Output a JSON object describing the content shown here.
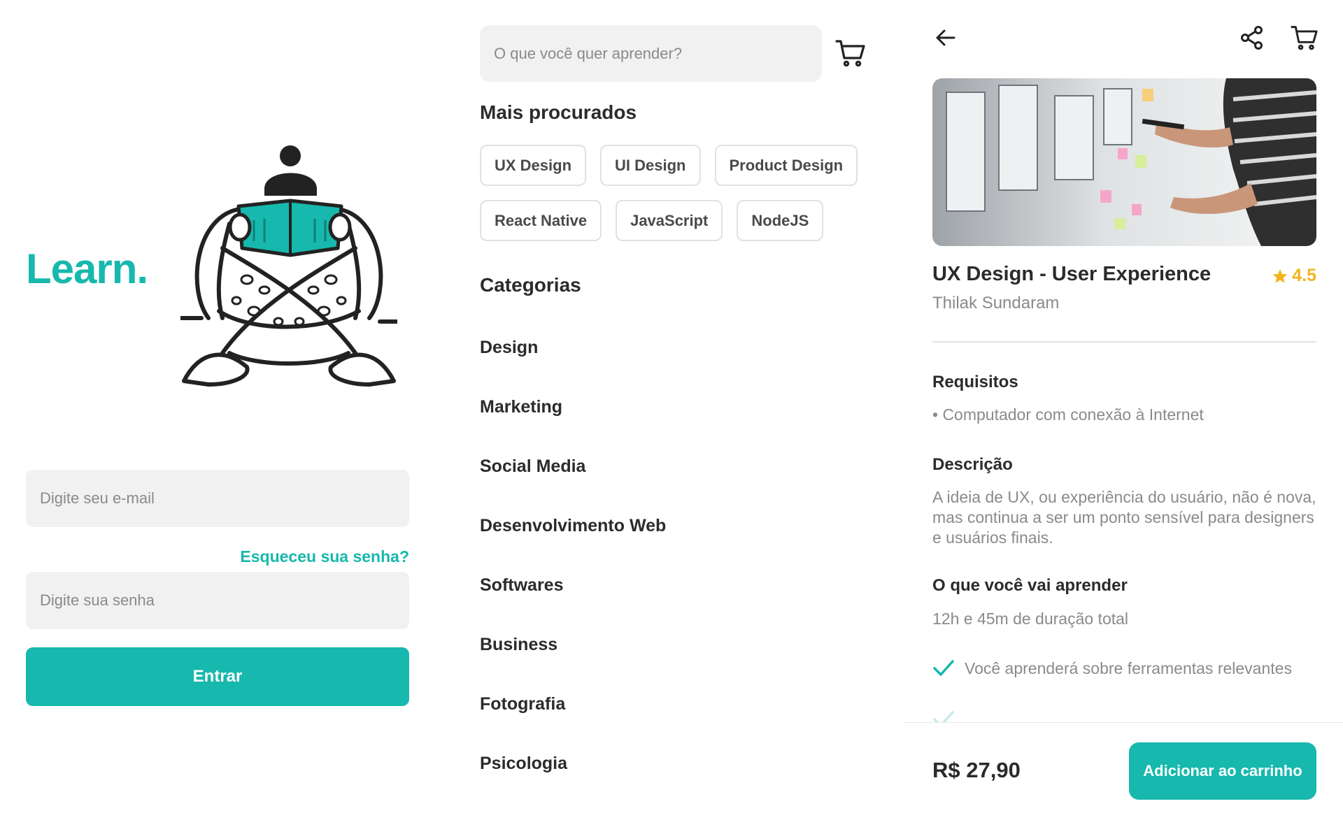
{
  "login": {
    "brand": "Learn.",
    "email_placeholder": "Digite seu e-mail",
    "forgot_password": "Esqueceu sua senha?",
    "password_placeholder": "Digite sua senha",
    "submit_label": "Entrar"
  },
  "browse": {
    "search_placeholder": "O que você quer aprender?",
    "popular_title": "Mais procurados",
    "popular_tags": [
      "UX Design",
      "UI Design",
      "Product Design",
      "React Native",
      "JavaScript",
      "NodeJS"
    ],
    "categories_title": "Categorias",
    "categories": [
      "Design",
      "Marketing",
      "Social Media",
      "Desenvolvimento Web",
      "Softwares",
      "Business",
      "Fotografia",
      "Psicologia"
    ]
  },
  "course": {
    "title": "UX Design - User Experience",
    "rating": "4.5",
    "author": "Thilak Sundaram",
    "requirements_title": "Requisitos",
    "requirements": [
      "• Computador com conexão à Internet"
    ],
    "description_title": "Descrição",
    "description": "A ideia de UX, ou experiência do usuário, não é nova, mas continua a ser um ponto sensível para designers e usuários finais.",
    "learn_title": "O que você vai aprender",
    "duration": "12h e 45m de duração total",
    "learn_items": [
      "Você aprenderá sobre ferramentas relevantes"
    ],
    "price": "R$ 27,90",
    "add_to_cart_label": "Adicionar ao carrinho"
  },
  "colors": {
    "accent": "#17b8ad",
    "star": "#f2b51e",
    "input_bg": "#f1f1f1",
    "text": "#2b2b2b",
    "muted": "#8a8a8a"
  },
  "icons": [
    "back-arrow-icon",
    "share-icon",
    "cart-icon",
    "star-icon",
    "check-icon"
  ]
}
